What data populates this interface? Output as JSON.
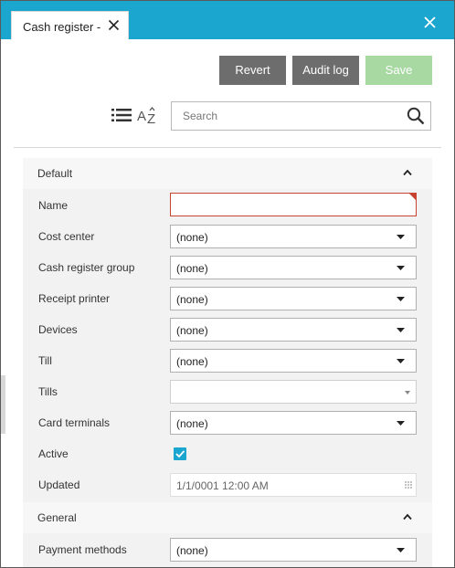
{
  "tab": {
    "title": "Cash register -"
  },
  "toolbar": {
    "revert_label": "Revert",
    "audit_log_label": "Audit log",
    "save_label": "Save"
  },
  "search": {
    "placeholder": "Search",
    "value": ""
  },
  "sections": {
    "default": {
      "title": "Default",
      "fields": {
        "name": {
          "label": "Name",
          "value": ""
        },
        "cost_center": {
          "label": "Cost center",
          "value": "(none)"
        },
        "cash_register_group": {
          "label": "Cash register group",
          "value": "(none)"
        },
        "receipt_printer": {
          "label": "Receipt printer",
          "value": "(none)"
        },
        "devices": {
          "label": "Devices",
          "value": "(none)"
        },
        "till": {
          "label": "Till",
          "value": "(none)"
        },
        "tills": {
          "label": "Tills",
          "value": ""
        },
        "card_terminals": {
          "label": "Card terminals",
          "value": "(none)"
        },
        "active": {
          "label": "Active",
          "checked": true
        },
        "updated": {
          "label": "Updated",
          "value": "1/1/0001 12:00 AM"
        }
      }
    },
    "general": {
      "title": "General",
      "fields": {
        "payment_methods": {
          "label": "Payment methods",
          "value": "(none)"
        }
      }
    }
  },
  "colors": {
    "accent": "#1ba6cf",
    "button_gray": "#6d6d6d",
    "save_disabled": "#a8d9a3",
    "required_red": "#c8432f",
    "panel_bg": "#f2f2f2"
  },
  "icons": [
    "close-icon",
    "list-view-icon",
    "sort-az-icon",
    "search-icon",
    "chevron-up-icon",
    "chevron-down-icon",
    "check-icon",
    "grip-icon"
  ]
}
